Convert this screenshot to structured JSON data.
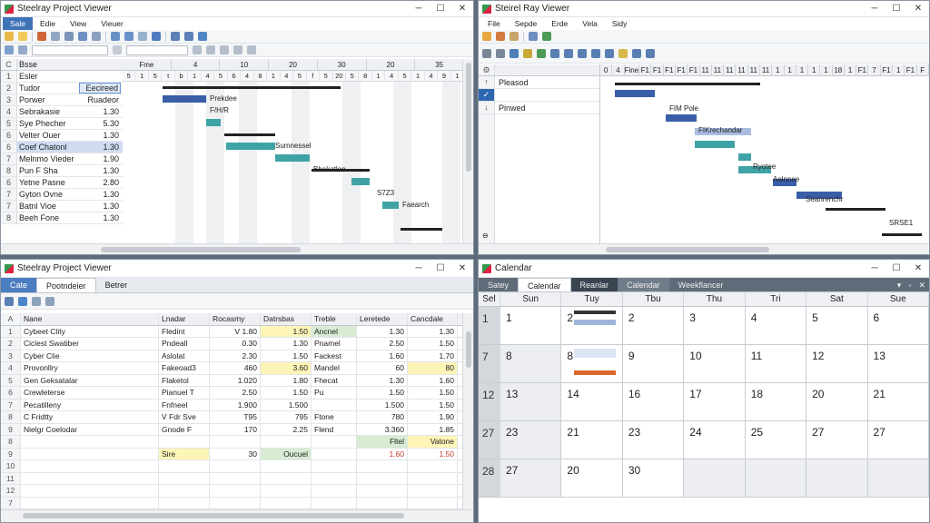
{
  "w1": {
    "title": "Steelray Project Viewer",
    "menu": [
      "Sale",
      "Edie",
      "View",
      "Vieuer"
    ],
    "table_header": [
      "C",
      "Bsse",
      "Fles"
    ],
    "rows": [
      {
        "n": "1",
        "name": "Esler",
        "dur": ""
      },
      {
        "n": "2",
        "name": "Tudor",
        "dur": "Eecireed"
      },
      {
        "n": "3",
        "name": "Porwer",
        "dur": "Ruadeor"
      },
      {
        "n": "4",
        "name": "Sebrakasie",
        "dur": "1.30"
      },
      {
        "n": "5",
        "name": "Sye Phecher",
        "dur": "5.30"
      },
      {
        "n": "6",
        "name": "Velter Ouer",
        "dur": "1.30"
      },
      {
        "n": "6",
        "name": "Coef Chatonl",
        "dur": "1.30"
      },
      {
        "n": "7",
        "name": "Melnmo Vieder",
        "dur": "1.90"
      },
      {
        "n": "8",
        "name": "Pun F Sha",
        "dur": "1.30"
      },
      {
        "n": "6",
        "name": "Yetne Pasne",
        "dur": "2.80"
      },
      {
        "n": "7",
        "name": "Gyton Ovne",
        "dur": "1.30"
      },
      {
        "n": "7",
        "name": "Batnl Vioe",
        "dur": "1.30"
      },
      {
        "n": "8",
        "name": "Beeh Fone",
        "dur": "1.30"
      }
    ],
    "scale_top": [
      "Fme",
      "4",
      "10",
      "20",
      "30",
      "20",
      "35"
    ],
    "scale_bottom": [
      "5",
      "1",
      "5",
      "t",
      "b",
      "1",
      "4",
      "5",
      "6",
      "4",
      "8",
      "1",
      "4",
      "5",
      "f",
      "5",
      "20",
      "5",
      "8",
      "1",
      "4",
      "5",
      "1",
      "4",
      "9",
      "1"
    ],
    "labels": [
      "Prekdee",
      "F/H/R",
      "Sumnessel",
      "Bhekatlon",
      "S7Z3",
      "Faearch"
    ],
    "bar_color": "#3a5fa8",
    "teal": "#3fa3a6"
  },
  "w2": {
    "title": "Steirel Ray Viewer",
    "menu": [
      "File",
      "Sepde",
      "Erde",
      "Vela",
      "Sidy"
    ],
    "rows": [
      "Pleasod",
      "Pinwed"
    ],
    "scale_top": [
      "0",
      "4",
      "Fine",
      "F1",
      "F1",
      "F1",
      "F1",
      "F1",
      "11",
      "11",
      "11",
      "11",
      "11",
      "11",
      "1",
      "1",
      "1",
      "1",
      "1",
      "18",
      "1",
      "F1",
      "7",
      "F1",
      "1",
      "F1",
      "F"
    ],
    "labels": [
      "FIM Pole",
      "FIKrechandar",
      "Ryotee",
      "Aelnnee",
      "Seanrenchr",
      "SRSE1"
    ]
  },
  "w3": {
    "title": "Steelray Project Viewer",
    "tabs": [
      "Cate",
      "Pootndeier",
      "Betrer"
    ],
    "columns": [
      "Nane",
      "Lnadar",
      "Rocasmy",
      "Datrsbas",
      "Treble",
      "Leretede",
      "Cancdale"
    ],
    "rows": [
      {
        "n": "1",
        "c": [
          "Cybeet Clity",
          "Fledint",
          "V 1.80",
          "1.50",
          "Ancnel",
          "1.30",
          "1.30"
        ]
      },
      {
        "n": "2",
        "c": [
          "Ciclest Swatiber",
          "Pndeall",
          "0.30",
          "1.30",
          "Pnamel",
          "2.50",
          "1.50"
        ]
      },
      {
        "n": "3",
        "c": [
          "Cyber Clie",
          "Aslolat",
          "2.30",
          "1.50",
          "Fackest",
          "1.60",
          "1.70"
        ]
      },
      {
        "n": "4",
        "c": [
          "Provonllry",
          "Fakeoad3",
          "460",
          "3.60",
          "Mandel",
          "60",
          "80"
        ]
      },
      {
        "n": "5",
        "c": [
          "Gen Geksatalar",
          "Flaketol",
          "1.020",
          "1.80",
          "Fhecat",
          "1.30",
          "1.60"
        ]
      },
      {
        "n": "6",
        "c": [
          "Crewleterse",
          "Pianuel T",
          "2.50",
          "1.50",
          "Pu",
          "1.50",
          "1.50"
        ]
      },
      {
        "n": "7",
        "c": [
          "Pecatilleny",
          "Fnfneel",
          "1.900",
          "1.500",
          "",
          "1.500",
          "1.50"
        ]
      },
      {
        "n": "8",
        "c": [
          "C Fridtty",
          "V Fdr Sve",
          "T95",
          "795",
          "Ftone",
          "780",
          "1.90"
        ]
      },
      {
        "n": "9",
        "c": [
          "Nielgr Coelodar",
          "Gnode F",
          "170",
          "2.25",
          "Flend",
          "3.360",
          "1.85"
        ]
      },
      {
        "n": "8",
        "c": [
          "",
          "",
          "",
          "",
          "",
          "Fltel",
          "Vatone"
        ]
      },
      {
        "n": "9",
        "c": [
          "",
          "Sire",
          "30",
          "Oucuel",
          "",
          "1.60",
          "1.50"
        ]
      },
      {
        "n": "10",
        "c": [
          "",
          "",
          "",
          "",
          "",
          "",
          ""
        ]
      },
      {
        "n": "11",
        "c": [
          "",
          "",
          "",
          "",
          "",
          "",
          ""
        ]
      },
      {
        "n": "12",
        "c": [
          "",
          "",
          "",
          "",
          "",
          "",
          ""
        ]
      },
      {
        "n": "7",
        "c": [
          "",
          "",
          "",
          "",
          "",
          "",
          ""
        ]
      }
    ],
    "yellow": "#fdf5b8",
    "green": "#d7ecd2"
  },
  "w4": {
    "title": "Calendar",
    "tabs": [
      "Satey",
      "Calendar",
      "Reanlar",
      "Calendar",
      "Weekflancer"
    ],
    "days": [
      "Sel",
      "Sun",
      "Tuy",
      "Tbu",
      "Thu",
      "Tri",
      "Sat",
      "Sue"
    ],
    "weeks": [
      {
        "wk": "1",
        "d": [
          "1",
          "2",
          "2",
          "3",
          "4",
          "5",
          "6"
        ]
      },
      {
        "wk": "7",
        "d": [
          "8",
          "8",
          "9",
          "10",
          "11",
          "12",
          "13"
        ]
      },
      {
        "wk": "12",
        "d": [
          "13",
          "14",
          "16",
          "17",
          "18",
          "20",
          "21"
        ]
      },
      {
        "wk": "27",
        "d": [
          "23",
          "21",
          "23",
          "24",
          "25",
          "27",
          "27"
        ]
      },
      {
        "wk": "28",
        "d": [
          "27",
          "20",
          "30",
          "",
          "",
          "",
          ""
        ]
      }
    ],
    "accent": "#d9682b"
  }
}
